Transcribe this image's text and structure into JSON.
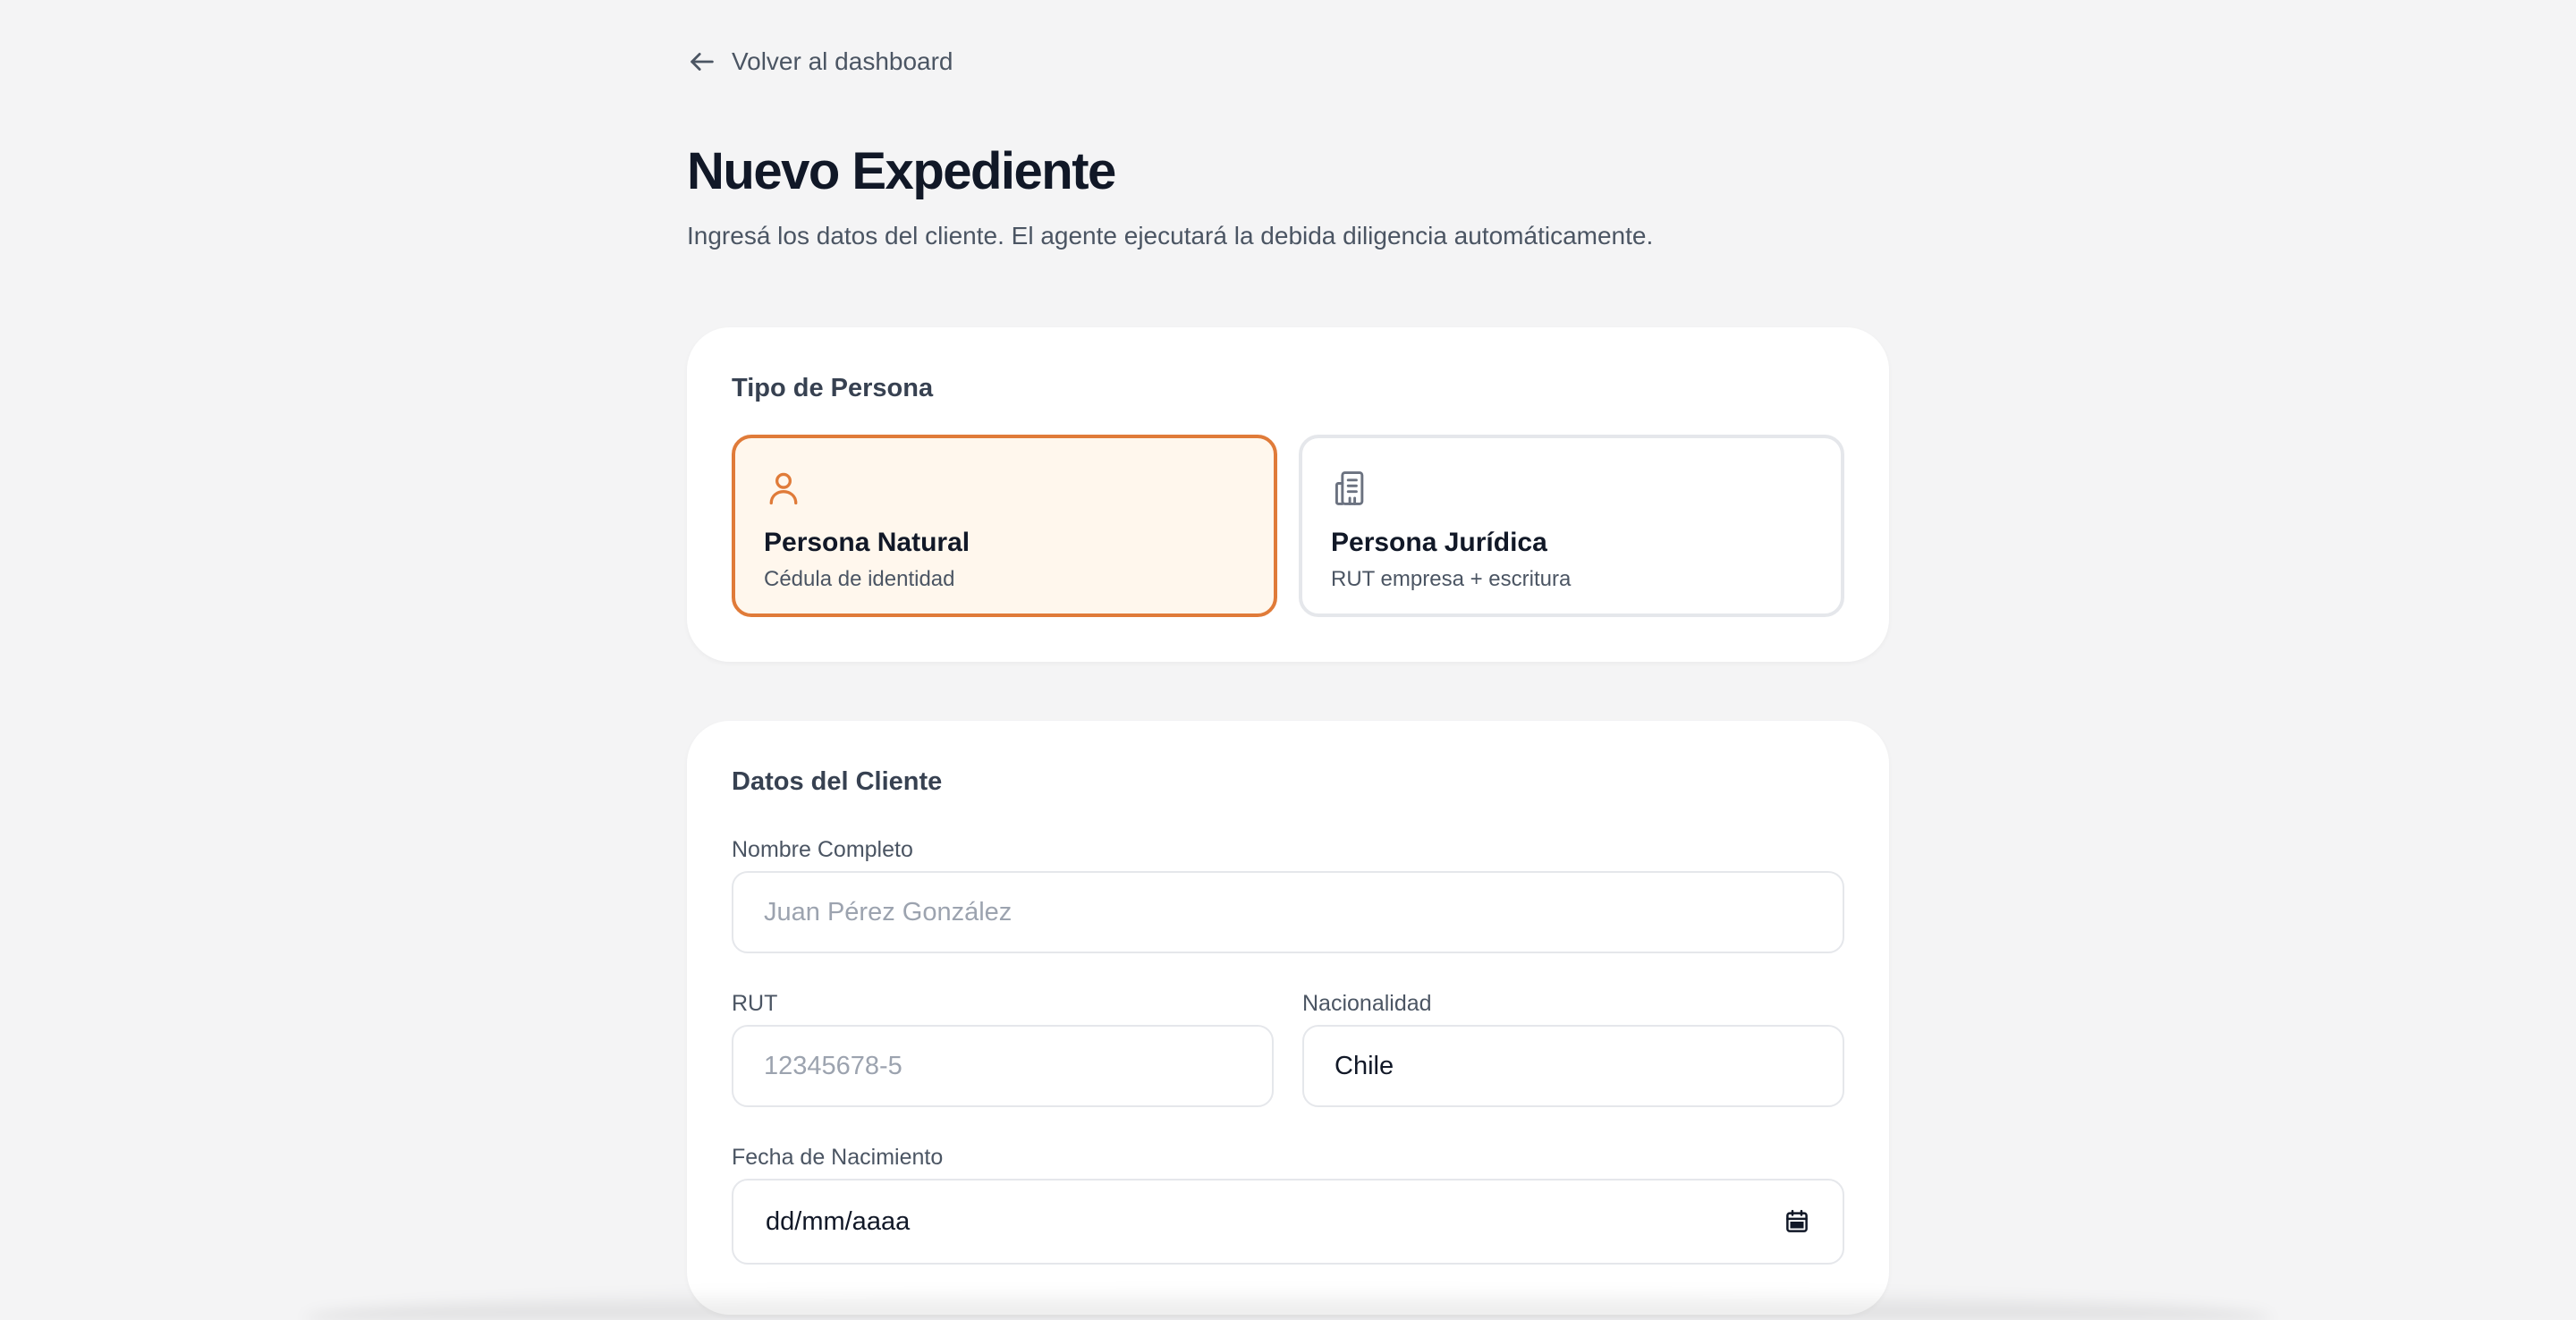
{
  "nav": {
    "back_label": "Volver al dashboard"
  },
  "header": {
    "title": "Nuevo Expediente",
    "subtitle": "Ingresá los datos del cliente. El agente ejecutará la debida diligencia automáticamente."
  },
  "person_type": {
    "heading": "Tipo de Persona",
    "options": [
      {
        "title": "Persona Natural",
        "description": "Cédula de identidad",
        "selected": true,
        "icon": "user-icon"
      },
      {
        "title": "Persona Jurídica",
        "description": "RUT empresa + escritura",
        "selected": false,
        "icon": "building-icon"
      }
    ]
  },
  "client": {
    "heading": "Datos del Cliente",
    "full_name": {
      "label": "Nombre Completo",
      "placeholder": "Juan Pérez González",
      "value": ""
    },
    "rut": {
      "label": "RUT",
      "placeholder": "12345678-5",
      "value": ""
    },
    "nationality": {
      "label": "Nacionalidad",
      "value": "Chile"
    },
    "birth_date": {
      "label": "Fecha de Nacimiento",
      "value": "dd/mm/aaaa",
      "icon": "calendar-icon"
    }
  },
  "colors": {
    "accent": "#e07b39",
    "accent_bg": "#fff7ed",
    "page_bg": "#f4f4f5",
    "text_primary": "#111827",
    "text_secondary": "#4b5563"
  }
}
